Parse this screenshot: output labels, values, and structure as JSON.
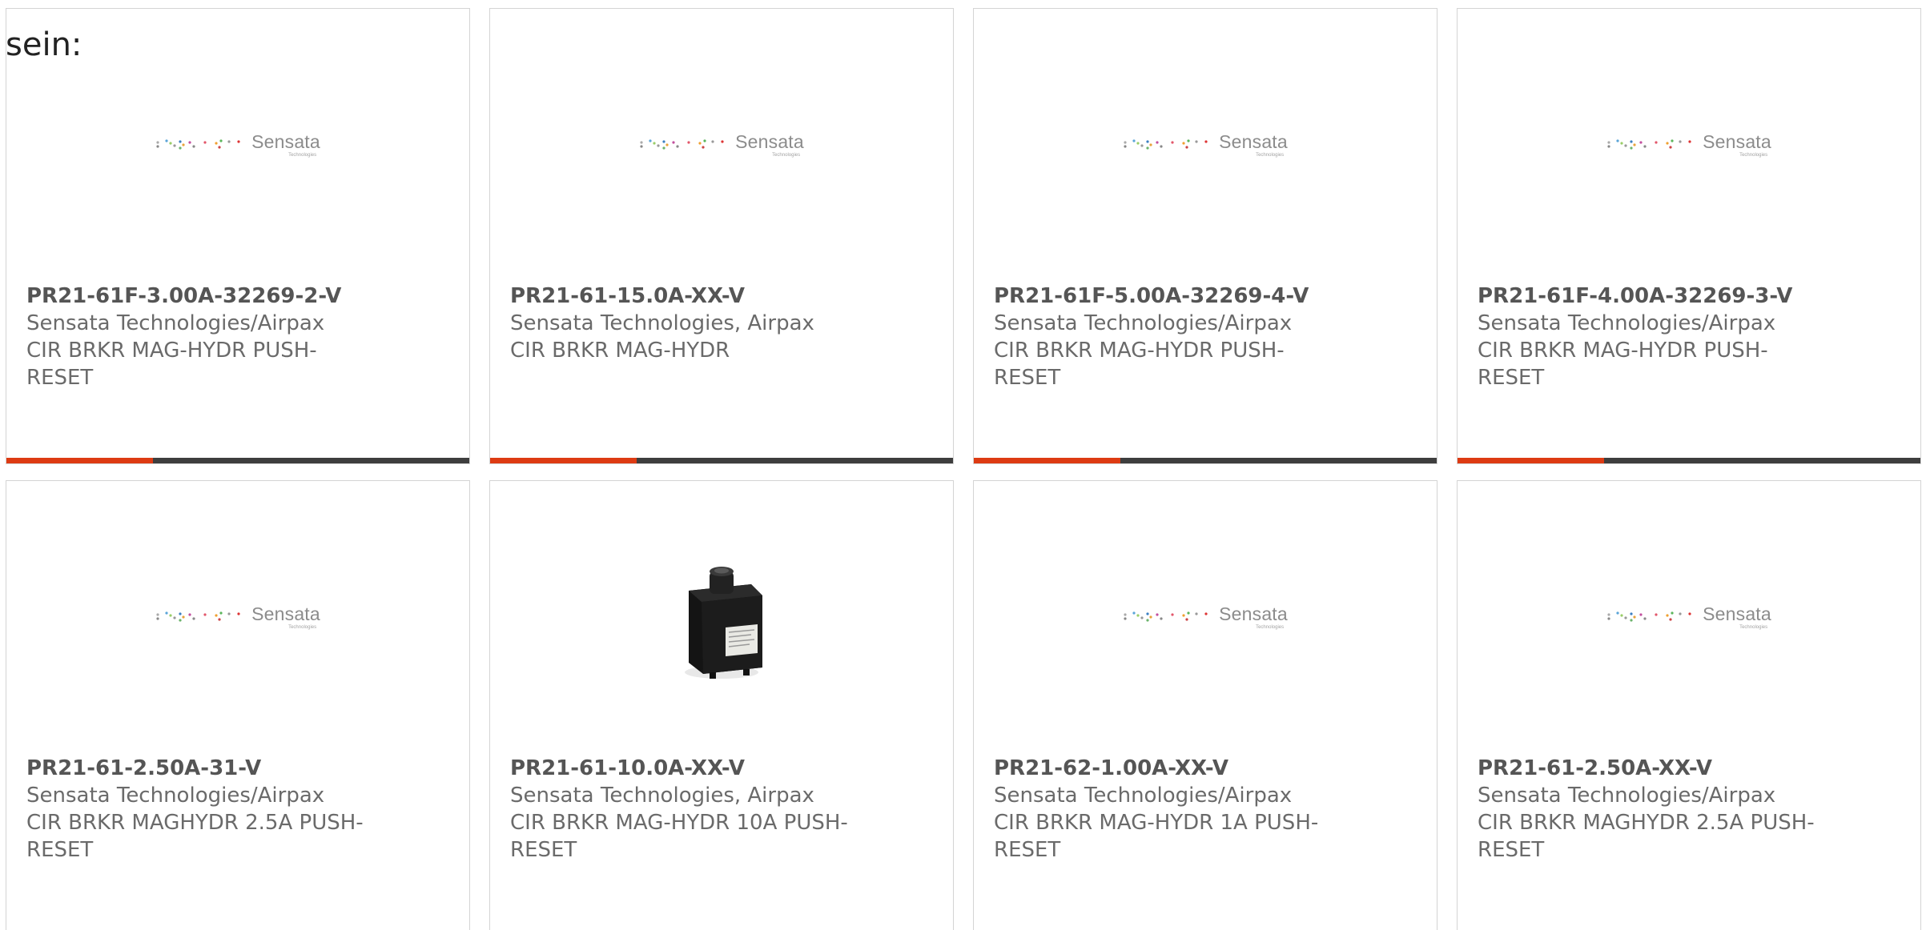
{
  "intro_text": "sein:",
  "logo": {
    "name": "Sensata",
    "sub": "Technologies"
  },
  "colors": {
    "accent": "#dd3b13",
    "bar": "#3e3e3e",
    "border": "#d4d4d4",
    "title_text": "#555555",
    "body_text": "#6a6a6a"
  },
  "products": [
    {
      "part_number": "PR21-61F-3.00A-32269-2-V",
      "manufacturer": "Sensata Technologies/Airpax",
      "description": "CIR BRKR MAG-HYDR PUSH-RESET",
      "image": "sensata-logo"
    },
    {
      "part_number": "PR21-61-15.0A-XX-V",
      "manufacturer": "Sensata Technologies, Airpax",
      "description": "CIR BRKR MAG-HYDR",
      "image": "sensata-logo"
    },
    {
      "part_number": "PR21-61F-5.00A-32269-4-V",
      "manufacturer": "Sensata Technologies/Airpax",
      "description": "CIR BRKR MAG-HYDR PUSH-RESET",
      "image": "sensata-logo"
    },
    {
      "part_number": "PR21-61F-4.00A-32269-3-V",
      "manufacturer": "Sensata Technologies/Airpax",
      "description": "CIR BRKR MAG-HYDR PUSH-RESET",
      "image": "sensata-logo"
    },
    {
      "part_number": "PR21-61-2.50A-31-V",
      "manufacturer": "Sensata Technologies/Airpax",
      "description": "CIR BRKR MAGHYDR 2.5A PUSH-RESET",
      "image": "sensata-logo"
    },
    {
      "part_number": "PR21-61-10.0A-XX-V",
      "manufacturer": "Sensata Technologies, Airpax",
      "description": "CIR BRKR MAG-HYDR 10A PUSH-RESET",
      "image": "product-photo"
    },
    {
      "part_number": "PR21-62-1.00A-XX-V",
      "manufacturer": "Sensata Technologies/Airpax",
      "description": "CIR BRKR MAG-HYDR 1A PUSH-RESET",
      "image": "sensata-logo"
    },
    {
      "part_number": "PR21-61-2.50A-XX-V",
      "manufacturer": "Sensata Technologies/Airpax",
      "description": "CIR BRKR MAGHYDR 2.5A PUSH-RESET",
      "image": "sensata-logo"
    }
  ]
}
